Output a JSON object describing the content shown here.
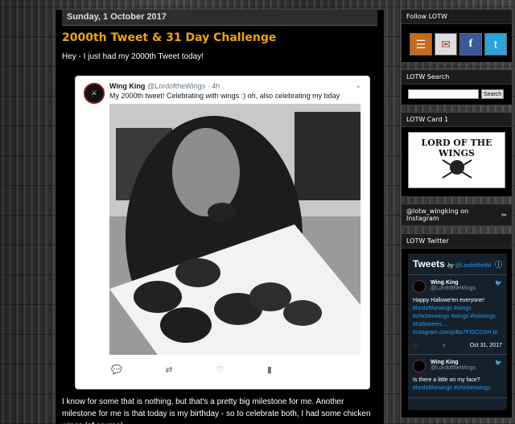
{
  "post": {
    "date_header": "Sunday, 1 October 2017",
    "title": "2000th Tweet & 31 Day Challenge",
    "intro": "Hey - I just had my 2000th Tweet today!",
    "body": "I know for some that is nothing, but that's a pretty big milestone for me. Another milestone for me is that today is my birthday - so to celebrate both, I had some chicken wings (of course)."
  },
  "embedded_tweet": {
    "name": "Wing King",
    "handle": "@LordoftheWings · 4h",
    "text": "My 2000th tweet! Celebrating with wings :) oh, also celebrating my bday",
    "actions": [
      "reply-icon",
      "retweet-icon",
      "like-icon",
      "stats-icon"
    ]
  },
  "sidebar": {
    "follow": {
      "title": "Follow LOTW",
      "icons": [
        "rss-icon",
        "email-icon",
        "facebook-icon",
        "twitter-icon"
      ]
    },
    "search": {
      "title": "LOTW Search",
      "button": "Search"
    },
    "card": {
      "title": "LOTW Card 1",
      "logo_text": "LORD OF THE WINGS"
    },
    "instagram": {
      "title": "@lotw_wingking on Instagram"
    },
    "twitter": {
      "title": "LOTW Twitter",
      "header": "Tweets",
      "by": "by",
      "by_handle": "@LordoftheWi",
      "tweets": [
        {
          "name": "Wing King",
          "handle": "@LordoftheWings",
          "text": "Happy Hallowe'en everyone!",
          "links": "#lordofthewings #wings #chickenwings #wings #hotwings #halloween,... instagram.com/p/Ba7FIGCDSH b/",
          "date": "Oct 31, 2017"
        },
        {
          "name": "Wing King",
          "handle": "@LordoftheWings",
          "text": "Is there a little on my face?",
          "links": "#lordofthewings #chickenwings",
          "date": ""
        }
      ]
    }
  },
  "colors": {
    "title_accent": "#f0a500",
    "twitter_link": "#1da1f2",
    "twitter_bg": "#15202b"
  }
}
